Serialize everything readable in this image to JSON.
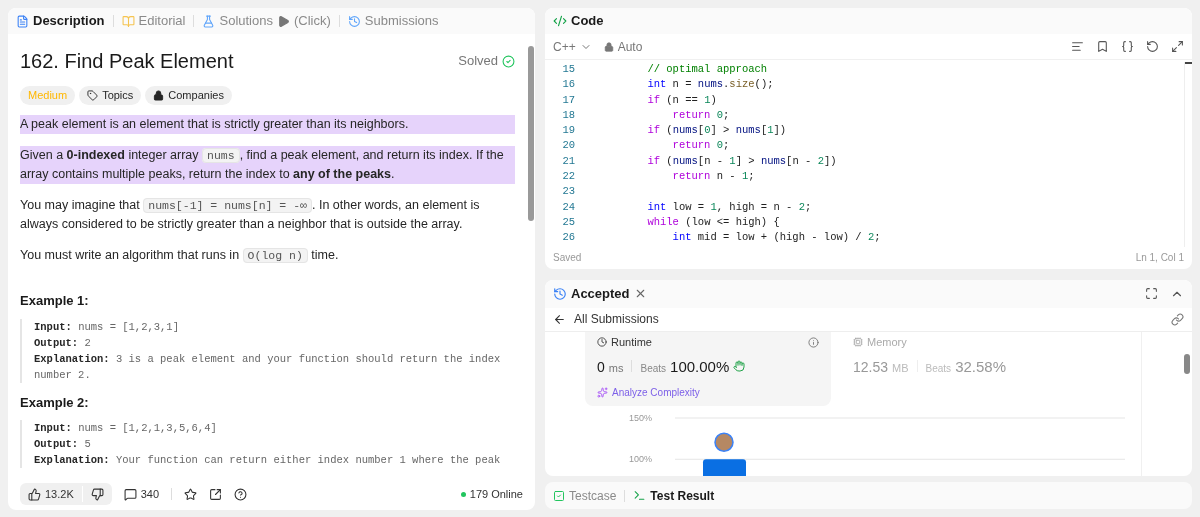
{
  "description_panel": {
    "tabs": [
      {
        "kind": "description",
        "label": "Description",
        "selected": true
      },
      {
        "kind": "editorial",
        "label": "Editorial",
        "selected": false
      },
      {
        "kind": "solutions",
        "label": "Solutions",
        "selected": false
      },
      {
        "kind": "click",
        "label": "(Click)",
        "selected": false
      },
      {
        "kind": "submissions",
        "label": "Submissions",
        "selected": false
      }
    ],
    "title": "162. Find Peak Element",
    "status": "Solved",
    "tags": [
      {
        "kind": "difficulty",
        "label": "Medium"
      },
      {
        "kind": "topics",
        "label": "Topics"
      },
      {
        "kind": "companies",
        "label": "Companies"
      }
    ],
    "paragraphs": [
      {
        "highlighted": true,
        "segments": [
          {
            "kind": "text",
            "text": "A peak element is an element that is strictly greater than its neighbors."
          }
        ]
      },
      {
        "highlighted": true,
        "segments": [
          {
            "kind": "text",
            "text": "Given a **0-indexed** integer array "
          },
          {
            "kind": "code",
            "text": "nums"
          },
          {
            "kind": "text",
            "text": ", find a peak element, and return its index. If the array contains multiple peaks, return the index to **any of the peaks**."
          }
        ]
      },
      {
        "highlighted": false,
        "segments": [
          {
            "kind": "text",
            "text": "You may imagine that "
          },
          {
            "kind": "code",
            "text": "nums[-1] = nums[n] = -∞"
          },
          {
            "kind": "text",
            "text": ". In other words, an element is always considered to be strictly greater than a neighbor that is outside the array."
          }
        ]
      },
      {
        "highlighted": false,
        "segments": [
          {
            "kind": "text",
            "text": "You must write an algorithm that runs in "
          },
          {
            "kind": "code",
            "text": "O(log n)"
          },
          {
            "kind": "text",
            "text": " time."
          }
        ]
      }
    ],
    "examples": [
      {
        "title": "Example 1:",
        "lines": [
          {
            "label": "Input:",
            "value": "nums = [1,2,3,1]"
          },
          {
            "label": "Output:",
            "value": "2"
          },
          {
            "label": "Explanation:",
            "value": "3 is a peak element and your function should return the index number 2."
          }
        ]
      },
      {
        "title": "Example 2:",
        "lines": [
          {
            "label": "Input:",
            "value": "nums = [1,2,1,3,5,6,4]"
          },
          {
            "label": "Output:",
            "value": "5"
          },
          {
            "label": "Explanation:",
            "value": "Your function can return either index number 1 where the peak"
          }
        ]
      }
    ],
    "footer": {
      "likes": "13.2K",
      "comments": "340",
      "online": "179 Online"
    }
  },
  "code_panel": {
    "title": "Code",
    "language": "C++",
    "mode": "Auto",
    "lines": [
      {
        "number": "15",
        "tokens": [
          {
            "kind": "comment",
            "text": "        // optimal approach"
          }
        ]
      },
      {
        "number": "16",
        "tokens": [
          {
            "kind": "type",
            "text": "        int"
          },
          {
            "kind": "plain",
            "text": " n = "
          },
          {
            "kind": "var",
            "text": "nums"
          },
          {
            "kind": "plain",
            "text": "."
          },
          {
            "kind": "fn",
            "text": "size"
          },
          {
            "kind": "plain",
            "text": "();"
          }
        ]
      },
      {
        "number": "17",
        "tokens": [
          {
            "kind": "keyword",
            "text": "        if"
          },
          {
            "kind": "plain",
            "text": " (n == "
          },
          {
            "kind": "num",
            "text": "1"
          },
          {
            "kind": "plain",
            "text": ")"
          }
        ]
      },
      {
        "number": "18",
        "tokens": [
          {
            "kind": "keyword",
            "text": "            return"
          },
          {
            "kind": "num",
            "text": " 0"
          },
          {
            "kind": "plain",
            "text": ";"
          }
        ]
      },
      {
        "number": "19",
        "tokens": [
          {
            "kind": "keyword",
            "text": "        if"
          },
          {
            "kind": "plain",
            "text": " ("
          },
          {
            "kind": "var",
            "text": "nums"
          },
          {
            "kind": "plain",
            "text": "["
          },
          {
            "kind": "num",
            "text": "0"
          },
          {
            "kind": "plain",
            "text": "] > "
          },
          {
            "kind": "var",
            "text": "nums"
          },
          {
            "kind": "plain",
            "text": "["
          },
          {
            "kind": "num",
            "text": "1"
          },
          {
            "kind": "plain",
            "text": "])"
          }
        ]
      },
      {
        "number": "20",
        "tokens": [
          {
            "kind": "keyword",
            "text": "            return"
          },
          {
            "kind": "num",
            "text": " 0"
          },
          {
            "kind": "plain",
            "text": ";"
          }
        ]
      },
      {
        "number": "21",
        "tokens": [
          {
            "kind": "keyword",
            "text": "        if"
          },
          {
            "kind": "plain",
            "text": " ("
          },
          {
            "kind": "var",
            "text": "nums"
          },
          {
            "kind": "plain",
            "text": "[n - "
          },
          {
            "kind": "num",
            "text": "1"
          },
          {
            "kind": "plain",
            "text": "] > "
          },
          {
            "kind": "var",
            "text": "nums"
          },
          {
            "kind": "plain",
            "text": "[n - "
          },
          {
            "kind": "num",
            "text": "2"
          },
          {
            "kind": "plain",
            "text": "])"
          }
        ]
      },
      {
        "number": "22",
        "tokens": [
          {
            "kind": "keyword",
            "text": "            return"
          },
          {
            "kind": "plain",
            "text": " n - "
          },
          {
            "kind": "num",
            "text": "1"
          },
          {
            "kind": "plain",
            "text": ";"
          }
        ]
      },
      {
        "number": "23"
      },
      {
        "number": "24",
        "tokens": [
          {
            "kind": "type",
            "text": "        int"
          },
          {
            "kind": "plain",
            "text": " low = "
          },
          {
            "kind": "num",
            "text": "1"
          },
          {
            "kind": "plain",
            "text": ", high = n - "
          },
          {
            "kind": "num",
            "text": "2"
          },
          {
            "kind": "plain",
            "text": ";"
          }
        ]
      },
      {
        "number": "25",
        "tokens": [
          {
            "kind": "keyword",
            "text": "        while"
          },
          {
            "kind": "plain",
            "text": " (low <= high) {"
          }
        ]
      },
      {
        "number": "26",
        "tokens": [
          {
            "kind": "type",
            "text": "            int"
          },
          {
            "kind": "plain",
            "text": " mid = low + (high - low) / "
          },
          {
            "kind": "num",
            "text": "2"
          },
          {
            "kind": "plain",
            "text": ";"
          }
        ]
      }
    ],
    "saved": "Saved",
    "cursor": "Ln 1, Col 1"
  },
  "result_panel": {
    "title": "Accepted",
    "back": "All Submissions",
    "runtime": {
      "label": "Runtime",
      "value": "0",
      "unit": "ms",
      "beats_label": "Beats",
      "beats": "100.00%",
      "analyze": "Analyze Complexity"
    },
    "memory": {
      "label": "Memory",
      "value": "12.53",
      "unit": "MB",
      "beats_label": "Beats",
      "beats": "32.58%"
    },
    "chart_data": {
      "type": "bar",
      "ylim": [
        70,
        150
      ],
      "yticks": [
        {
          "value": 100,
          "label": "100%"
        },
        {
          "value": 150,
          "label": "150%"
        }
      ],
      "values": [
        100
      ]
    }
  },
  "bottom_tabs": [
    {
      "kind": "testcase",
      "label": "Testcase",
      "selected": false
    },
    {
      "kind": "result",
      "label": "Test Result",
      "selected": true
    }
  ]
}
